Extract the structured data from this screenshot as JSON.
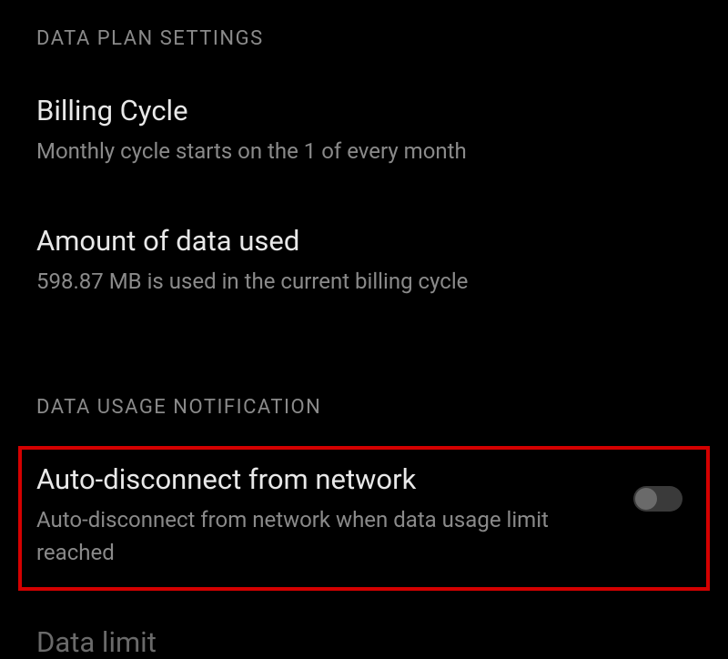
{
  "sections": {
    "data_plan": {
      "header": "DATA PLAN SETTINGS",
      "billing_cycle": {
        "title": "Billing Cycle",
        "description": "Monthly cycle starts on the 1 of every month"
      },
      "data_used": {
        "title": "Amount of data used",
        "description": " 598.87 MB is used in the current billing cycle"
      }
    },
    "data_usage_notification": {
      "header": "DATA USAGE NOTIFICATION",
      "auto_disconnect": {
        "title": "Auto-disconnect from network",
        "description": "Auto-disconnect from network when data usage limit reached",
        "toggle_state": "off"
      },
      "data_limit": {
        "title": "Data limit"
      }
    }
  }
}
